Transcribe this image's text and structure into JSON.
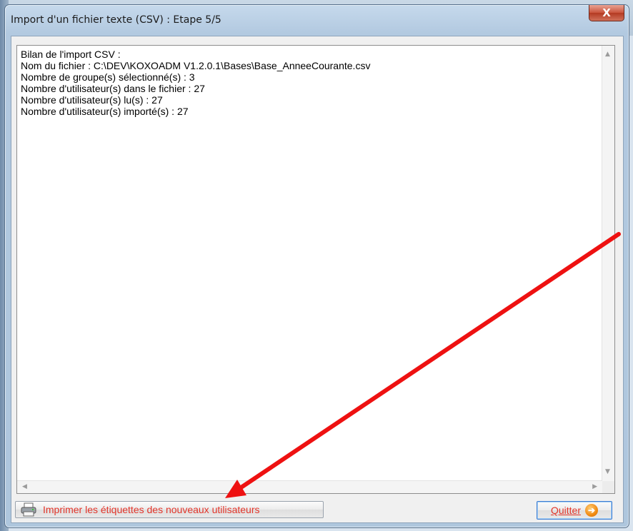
{
  "window": {
    "title": "Import d'un fichier texte (CSV) : Etape 5/5",
    "close_label": "X"
  },
  "log": {
    "lines": [
      "Bilan de l'import CSV :",
      "Nom du fichier : C:\\DEV\\KOXOADM V1.2.0.1\\Bases\\Base_AnneeCourante.csv",
      "Nombre de groupe(s) sélectionné(s) : 3",
      "Nombre d'utilisateur(s) dans le fichier : 27",
      "Nombre d'utilisateur(s) lu(s) : 27",
      "Nombre d'utilisateur(s) importé(s) : 27"
    ]
  },
  "buttons": {
    "print_label": "Imprimer les étiquettes des nouveaux utilisateurs",
    "print_icon": "printer-icon",
    "quit_label": "Quitter",
    "quit_icon": "arrow-right-icon"
  },
  "annotation": {
    "color": "#ee1111"
  },
  "colors": {
    "button_text": "#e2352a",
    "close_button": "#c9533b"
  }
}
